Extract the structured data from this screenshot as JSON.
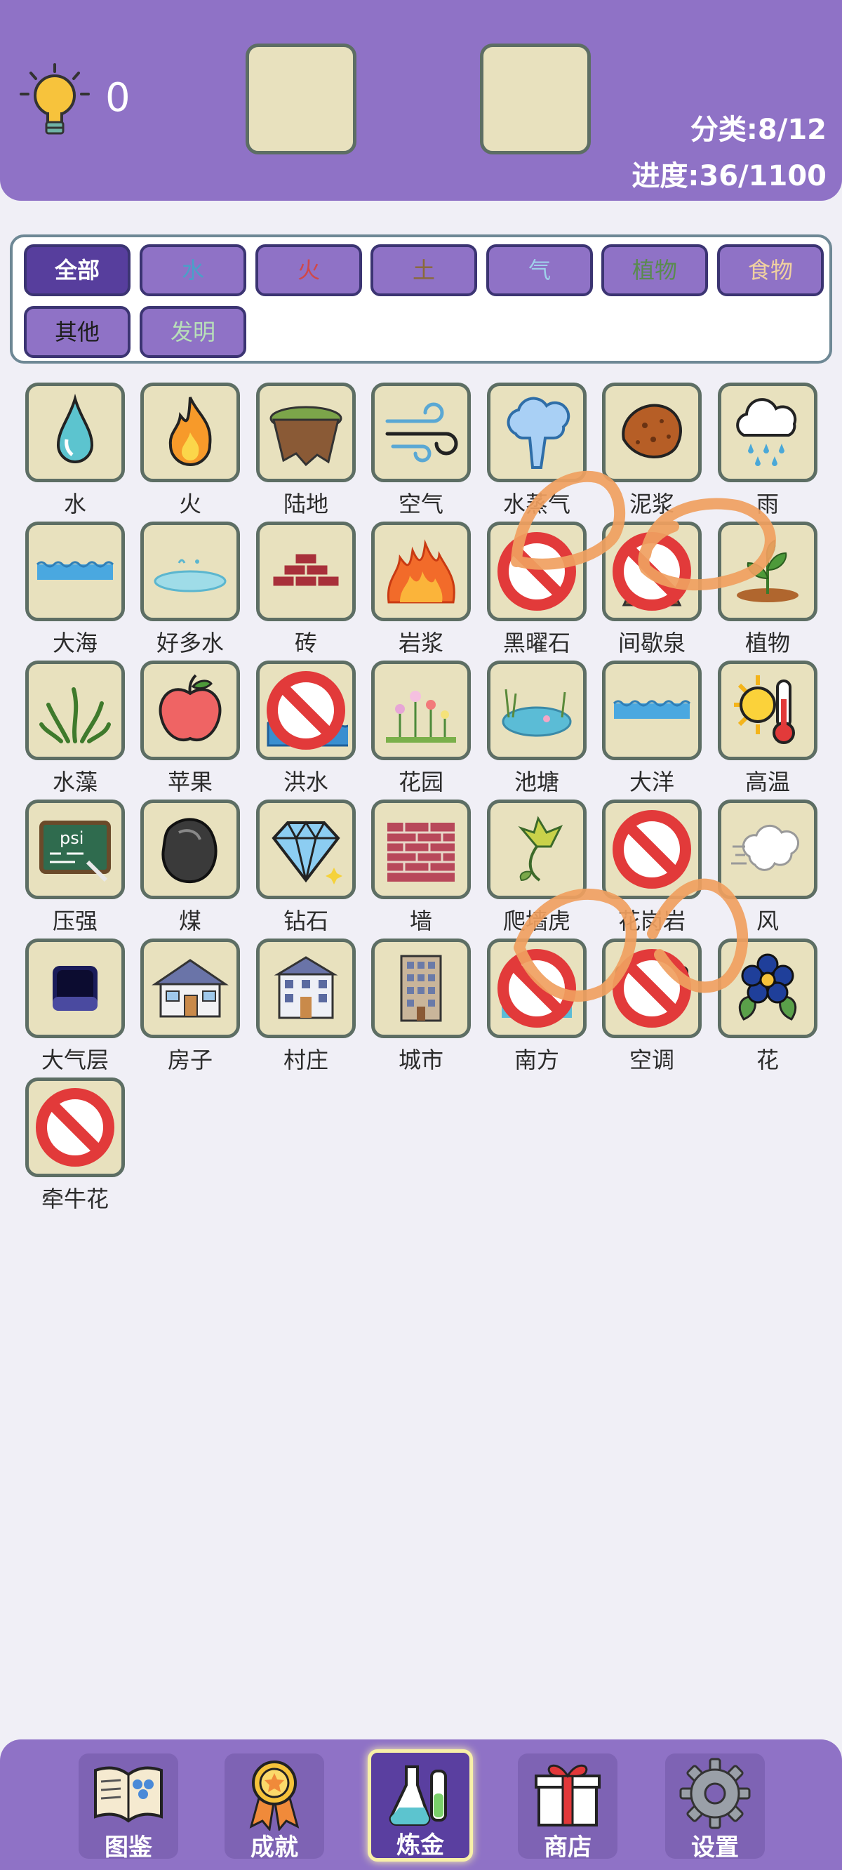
{
  "header": {
    "hint_count": "0",
    "category_stat": "分类:8/12",
    "progress_stat": "进度:36/1100"
  },
  "filters": [
    {
      "label": "全部",
      "color": "#ffffff",
      "active": true
    },
    {
      "label": "水",
      "color": "#4aa0c8"
    },
    {
      "label": "火",
      "color": "#d0484a"
    },
    {
      "label": "土",
      "color": "#8a6a3a"
    },
    {
      "label": "气",
      "color": "#9fd0ea"
    },
    {
      "label": "植物",
      "color": "#5a8a50"
    },
    {
      "label": "食物",
      "color": "#f0d0a0"
    },
    {
      "label": "其他",
      "color": "#1e1e1e"
    },
    {
      "label": "发明",
      "color": "#b8e0b8"
    }
  ],
  "items": [
    {
      "label": "水",
      "icon": "water-drop-icon"
    },
    {
      "label": "火",
      "icon": "fire-icon"
    },
    {
      "label": "陆地",
      "icon": "land-icon"
    },
    {
      "label": "空气",
      "icon": "air-icon"
    },
    {
      "label": "水蒸气",
      "icon": "steam-icon"
    },
    {
      "label": "泥浆",
      "icon": "mud-icon"
    },
    {
      "label": "雨",
      "icon": "rain-icon"
    },
    {
      "label": "大海",
      "icon": "sea-icon"
    },
    {
      "label": "好多水",
      "icon": "puddle-icon"
    },
    {
      "label": "砖",
      "icon": "brick-icon"
    },
    {
      "label": "岩浆",
      "icon": "lava-icon"
    },
    {
      "label": "黑曜石",
      "icon": "obsidian-icon",
      "banned": true
    },
    {
      "label": "间歇泉",
      "icon": "geyser-icon",
      "banned": true
    },
    {
      "label": "植物",
      "icon": "plant-icon"
    },
    {
      "label": "水藻",
      "icon": "algae-icon"
    },
    {
      "label": "苹果",
      "icon": "apple-icon"
    },
    {
      "label": "洪水",
      "icon": "flood-icon",
      "banned": true
    },
    {
      "label": "花园",
      "icon": "garden-icon"
    },
    {
      "label": "池塘",
      "icon": "pond-icon"
    },
    {
      "label": "大洋",
      "icon": "ocean-icon"
    },
    {
      "label": "高温",
      "icon": "heat-icon"
    },
    {
      "label": "压强",
      "icon": "pressure-board-icon"
    },
    {
      "label": "煤",
      "icon": "coal-icon"
    },
    {
      "label": "钻石",
      "icon": "diamond-icon"
    },
    {
      "label": "墙",
      "icon": "wall-icon"
    },
    {
      "label": "爬墙虎",
      "icon": "ivy-icon"
    },
    {
      "label": "花岗岩",
      "icon": "granite-icon",
      "banned": true
    },
    {
      "label": "风",
      "icon": "wind-icon"
    },
    {
      "label": "大气层",
      "icon": "atmosphere-icon"
    },
    {
      "label": "房子",
      "icon": "house-icon"
    },
    {
      "label": "村庄",
      "icon": "village-icon"
    },
    {
      "label": "城市",
      "icon": "city-icon"
    },
    {
      "label": "南方",
      "icon": "south-icon",
      "banned": true
    },
    {
      "label": "空调",
      "icon": "air-conditioner-icon",
      "banned": true
    },
    {
      "label": "花",
      "icon": "flower-icon"
    },
    {
      "label": "牵牛花",
      "icon": "morning-glory-icon",
      "banned": true
    }
  ],
  "nav": [
    {
      "label": "图鉴",
      "icon": "book-icon"
    },
    {
      "label": "成就",
      "icon": "medal-icon"
    },
    {
      "label": "炼金",
      "icon": "flask-icon",
      "active": true
    },
    {
      "label": "商店",
      "icon": "gift-icon"
    },
    {
      "label": "设置",
      "icon": "gear-icon"
    }
  ],
  "colors": {
    "header_bg": "#8f72c6",
    "chip_bg": "#8f72c6",
    "chip_active_bg": "#573e9d",
    "tile_bg": "#e8e1be",
    "tile_border": "#5d6e64",
    "scribble": "#f0a060",
    "page_bg": "#f0eff6"
  }
}
